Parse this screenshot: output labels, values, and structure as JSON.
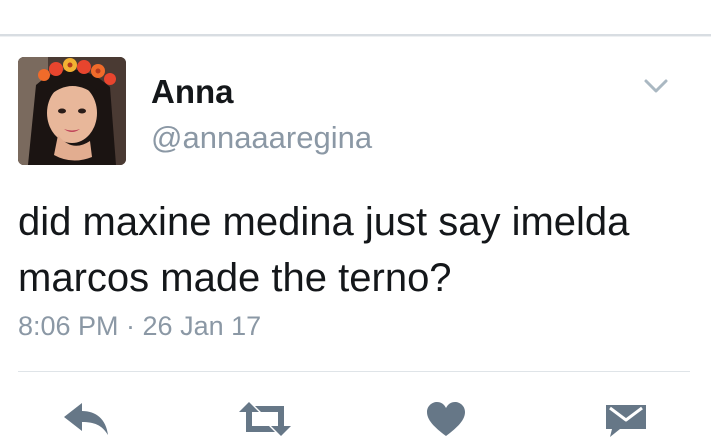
{
  "tweet": {
    "display_name": "Anna",
    "handle": "@annaaaregina",
    "text": "did maxine medina just say imelda\nmarcos made the terno?",
    "timestamp": "8:06 PM · 26 Jan 17"
  },
  "icons": {
    "menu": "chevron-down-icon",
    "reply": "reply-icon",
    "retweet": "retweet-icon",
    "like": "heart-icon",
    "dm": "envelope-icon"
  },
  "colors": {
    "text": "#14171a",
    "muted": "#8b98a5",
    "icon": "#667787",
    "divider": "#dfe4e8"
  }
}
